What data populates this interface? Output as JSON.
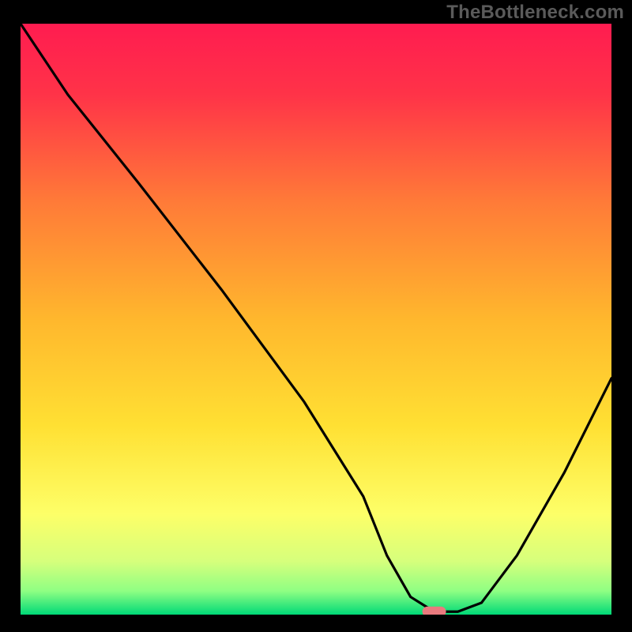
{
  "watermark": "TheBottleneck.com",
  "chart_data": {
    "type": "line",
    "title": "",
    "xlabel": "",
    "ylabel": "",
    "xlim": [
      0,
      100
    ],
    "ylim": [
      0,
      100
    ],
    "grid": false,
    "background_gradient": {
      "top": "#ff1a4e",
      "mid_upper": "#ff8934",
      "mid": "#ffd22a",
      "mid_lower": "#fff95e",
      "near_bottom": "#c7ff74",
      "bottom": "#00e17a"
    },
    "series": [
      {
        "name": "bottleneck-curve",
        "color": "#000000",
        "x": [
          0,
          8,
          20,
          34,
          48,
          58,
          62,
          66,
          70,
          74,
          78,
          84,
          92,
          100
        ],
        "y": [
          100,
          88,
          73,
          55,
          36,
          20,
          10,
          3,
          0.5,
          0.5,
          2,
          10,
          24,
          40
        ]
      }
    ],
    "marker": {
      "name": "optimal-point",
      "x": 70,
      "y": 0.5,
      "color": "#e97a7e",
      "shape": "pill"
    }
  }
}
